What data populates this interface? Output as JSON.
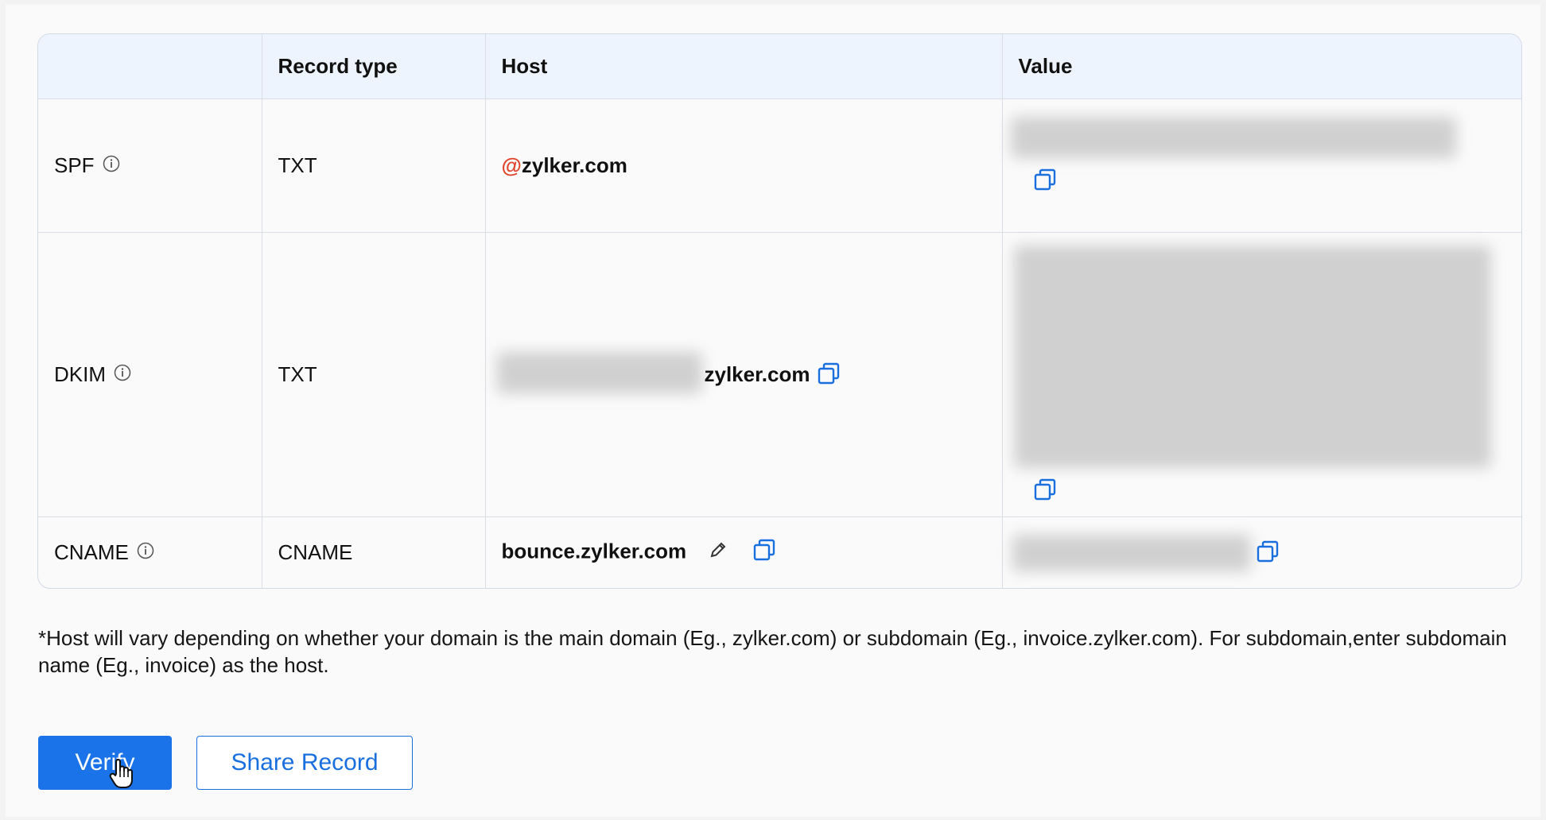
{
  "table": {
    "headers": [
      "",
      "Record type",
      "Host",
      "Value"
    ],
    "rows": [
      {
        "name": "SPF",
        "type": "TXT",
        "host_prefix": "@",
        "host": "zylker.com"
      },
      {
        "name": "DKIM",
        "type": "TXT",
        "host_prefix": "",
        "host": "zylker.com"
      },
      {
        "name": "CNAME",
        "type": "CNAME",
        "host_prefix": "",
        "host": "bounce.zylker.com"
      }
    ]
  },
  "note": "*Host will vary depending on whether your domain is the main domain (Eg., zylker.com) or subdomain (Eg., invoice.zylker.com). For subdomain,enter subdomain name (Eg., invoice) as the host.",
  "buttons": {
    "verify": "Verify",
    "share": "Share Record"
  },
  "icons": {
    "info": "info-icon",
    "copy": "copy-icon",
    "edit": "pencil-icon",
    "cursor": "hand-cursor-icon"
  },
  "colors": {
    "primary": "#1a73e8",
    "header_bg": "#eef4fe",
    "at_sign": "#e0442c"
  }
}
